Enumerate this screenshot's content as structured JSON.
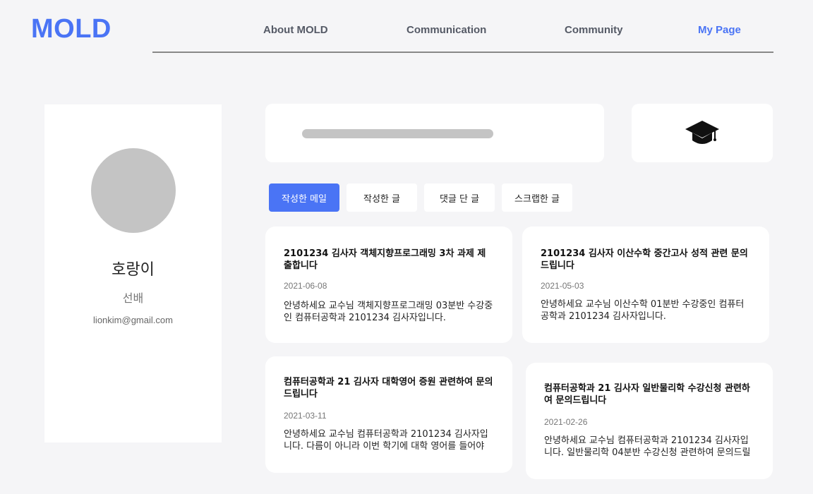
{
  "brand": {
    "logo": "MOLD",
    "accent": "#4a74f5"
  },
  "nav": {
    "items": [
      {
        "label": "About MOLD"
      },
      {
        "label": "Communication"
      },
      {
        "label": "Community"
      },
      {
        "label": "My Page"
      }
    ],
    "active": "My Page"
  },
  "profile": {
    "name": "호랑이",
    "role": "선배",
    "email": "lionkim@gmail.com"
  },
  "header_icons": {
    "graduation": "graduation-cap-icon"
  },
  "tabs": [
    {
      "label": "작성한 메일",
      "active": true
    },
    {
      "label": "작성한 글",
      "active": false
    },
    {
      "label": "댓글 단 글",
      "active": false
    },
    {
      "label": "스크랩한 글",
      "active": false
    }
  ],
  "mails": [
    {
      "title": "2101234 김사자 객체지향프로그래밍 3차 과제 제출합니다",
      "date": "2021-06-08",
      "body": "안녕하세요 교수님 객체지향프로그래밍 03분반 수강중인 컴퓨터공학과 2101234 김사자입니다."
    },
    {
      "title": "2101234 김사자 이산수학 중간고사 성적 관련 문의드립니다",
      "date": "2021-05-03",
      "body": "안녕하세요 교수님 이산수학 01분반 수강중인 컴퓨터공학과 2101234 김사자입니다."
    },
    {
      "title": "컴퓨터공학과 21 김사자 대학영어 증원 관련하여 문의드립니다",
      "date": "2021-03-11",
      "body": "안녕하세요 교수님 컴퓨터공학과 2101234 김사자입니다. 다름이 아니라 이번 학기에 대학 영어를 들어야 하는"
    },
    {
      "title": "컴퓨터공학과 21 김사자 일반물리학 수강신청 관련하여 문의드립니다",
      "date": "2021-02-26",
      "body": "안녕하세요 교수님 컴퓨터공학과 2101234 김사자입니다. 일반물리학 04분반 수강신청 관련하여 문의드릴"
    }
  ]
}
